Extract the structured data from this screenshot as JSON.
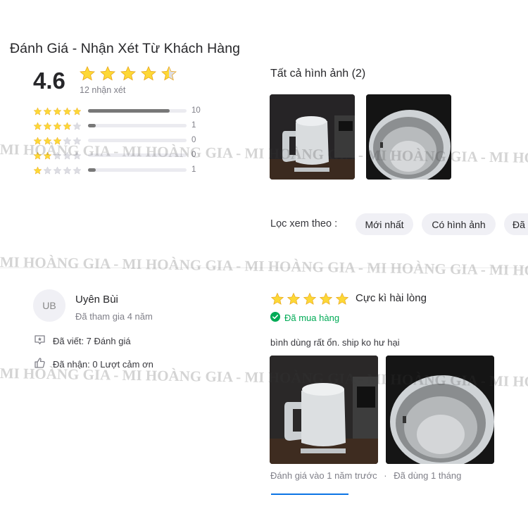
{
  "header": {
    "title": "Đánh Giá - Nhận Xét Từ Khách Hàng"
  },
  "summary": {
    "score": "4.6",
    "star_rating": 4.5,
    "count_text": "12 nhận xét",
    "breakdown": [
      {
        "stars": 5,
        "count": "10",
        "fraction": 0.83
      },
      {
        "stars": 4,
        "count": "1",
        "fraction": 0.08
      },
      {
        "stars": 3,
        "count": "0",
        "fraction": 0
      },
      {
        "stars": 2,
        "count": "0",
        "fraction": 0
      },
      {
        "stars": 1,
        "count": "1",
        "fraction": 0.08
      }
    ]
  },
  "photos": {
    "title": "Tất cả hình ảnh (2)"
  },
  "filter": {
    "label": "Lọc xem theo :",
    "chips": [
      "Mới nhất",
      "Có hình ảnh",
      "Đã"
    ]
  },
  "reviewer": {
    "initials": "UB",
    "name": "Uyên Bùi",
    "joined": "Đã tham gia 4 năm",
    "written": "Đã viết: 7 Đánh giá",
    "received": "Đã nhận: 0 Lượt cảm ơn"
  },
  "review": {
    "stars": 5,
    "title": "Cực kì hài lòng",
    "bought": "Đã mua hàng",
    "text": "bình dùng rất ổn. ship ko hư hại",
    "time": "Đánh giá vào 1 năm trước",
    "used": "Đã dùng 1 tháng"
  },
  "watermark": {
    "line_a": "MI HOÀNG GIA - MI HOÀNG GIA - MI HOÀNG GIA - MI HOÀNG GIA - MI HO",
    "line_b": "MI HOÀNG GIA - MI HOÀNG GIA - MI HOÀNG GIA - MI HOÀNG GIA - MI HO",
    "line_c": "MI HOÀNG GIA - MI HOÀNG GIA - MI HOÀNG GIA - MI HOÀNG GIA - MI HO"
  },
  "colors": {
    "star": "#fdd836",
    "star_empty": "#dddde3",
    "verified": "#00ab56",
    "accent": "#0b74e5"
  }
}
